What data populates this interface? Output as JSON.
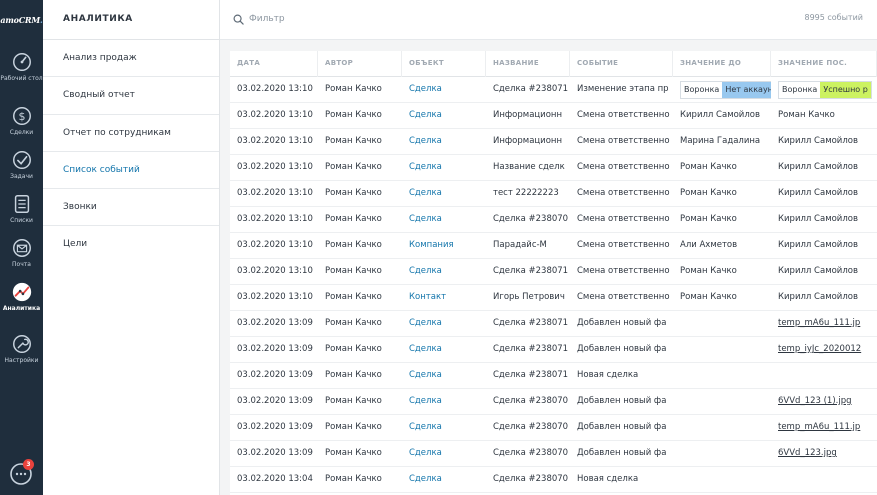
{
  "brand": {
    "logo_text": "amoCRM",
    "logo_dot": "."
  },
  "rail": [
    {
      "name": "dashboard",
      "label": "Рабочий стол",
      "active": false
    },
    {
      "name": "leads",
      "label": "Сделки",
      "active": false
    },
    {
      "name": "tasks",
      "label": "Задачи",
      "active": false
    },
    {
      "name": "lists",
      "label": "Списки",
      "active": false
    },
    {
      "name": "mail",
      "label": "Почта",
      "active": false
    },
    {
      "name": "analytics",
      "label": "Аналитика",
      "active": true
    },
    {
      "name": "settings",
      "label": "Настройки",
      "active": false
    }
  ],
  "chat": {
    "badge": "3"
  },
  "sidebar": {
    "title": "АНАЛИТИКА",
    "items": [
      {
        "label": "Анализ продаж"
      },
      {
        "label": "Сводный отчет"
      },
      {
        "label": "Отчет по сотрудникам"
      },
      {
        "label": "Список событий"
      },
      {
        "label": "Звонки"
      },
      {
        "label": "Цели"
      }
    ]
  },
  "search": {
    "placeholder": "Фильтр",
    "value": ""
  },
  "events_count": "8995 событий",
  "table": {
    "columns": [
      "ДАТА",
      "АВТОР",
      "ОБЪЕКТ",
      "НАЗВАНИЕ",
      "СОБЫТИЕ",
      "ЗНАЧЕНИЕ ДО",
      "ЗНАЧЕНИЕ ПОС."
    ],
    "rows": [
      {
        "date": "03.02.2020 13:10",
        "author": "Роман Качко",
        "object": "Сделка",
        "name": "Сделка #238071",
        "event": "Изменение этапа пр",
        "before": "",
        "after": "",
        "before_pill": [
          "Воронка",
          "Нет аккаун"
        ],
        "after_pill": [
          "Воронка",
          "Успешно р"
        ]
      },
      {
        "date": "03.02.2020 13:10",
        "author": "Роман Качко",
        "object": "Сделка",
        "name": "Информационн",
        "event": "Смена ответственно",
        "before": "Кирилл Самойлов",
        "after": "Роман Качко"
      },
      {
        "date": "03.02.2020 13:10",
        "author": "Роман Качко",
        "object": "Сделка",
        "name": "Информационн",
        "event": "Смена ответственно",
        "before": "Марина Гадалина",
        "after": "Кирилл Самойлов"
      },
      {
        "date": "03.02.2020 13:10",
        "author": "Роман Качко",
        "object": "Сделка",
        "name": "Название сделк",
        "event": "Смена ответственно",
        "before": "Роман Качко",
        "after": "Кирилл Самойлов"
      },
      {
        "date": "03.02.2020 13:10",
        "author": "Роман Качко",
        "object": "Сделка",
        "name": "тест 22222223",
        "event": "Смена ответственно",
        "before": "Роман Качко",
        "after": "Кирилл Самойлов"
      },
      {
        "date": "03.02.2020 13:10",
        "author": "Роман Качко",
        "object": "Сделка",
        "name": "Сделка #238070",
        "event": "Смена ответственно",
        "before": "Роман Качко",
        "after": "Кирилл Самойлов"
      },
      {
        "date": "03.02.2020 13:10",
        "author": "Роман Качко",
        "object": "Компания",
        "name": "Парадайс-М",
        "event": "Смена ответственно",
        "before": "Али Ахметов",
        "after": "Кирилл Самойлов"
      },
      {
        "date": "03.02.2020 13:10",
        "author": "Роман Качко",
        "object": "Сделка",
        "name": "Сделка #238071",
        "event": "Смена ответственно",
        "before": "Роман Качко",
        "after": "Кирилл Самойлов"
      },
      {
        "date": "03.02.2020 13:10",
        "author": "Роман Качко",
        "object": "Контакт",
        "name": "Игорь Петрович",
        "event": "Смена ответственно",
        "before": "Роман Качко",
        "after": "Кирилл Самойлов"
      },
      {
        "date": "03.02.2020 13:09",
        "author": "Роман Качко",
        "object": "Сделка",
        "name": "Сделка #238071",
        "event": "Добавлен новый фа",
        "before": "",
        "after": "temp_mA6u_111.jp",
        "after_file": true
      },
      {
        "date": "03.02.2020 13:09",
        "author": "Роман Качко",
        "object": "Сделка",
        "name": "Сделка #238071",
        "event": "Добавлен новый фа",
        "before": "",
        "after": "temp_iyJc_2020012",
        "after_file": true
      },
      {
        "date": "03.02.2020 13:09",
        "author": "Роман Качко",
        "object": "Сделка",
        "name": "Сделка #238071",
        "event": "Новая сделка",
        "before": "",
        "after": ""
      },
      {
        "date": "03.02.2020 13:09",
        "author": "Роман Качко",
        "object": "Сделка",
        "name": "Сделка #238070",
        "event": "Добавлен новый фа",
        "before": "",
        "after": "6VVd_123 (1).jpg",
        "after_file": true
      },
      {
        "date": "03.02.2020 13:09",
        "author": "Роман Качко",
        "object": "Сделка",
        "name": "Сделка #238070",
        "event": "Добавлен новый фа",
        "before": "",
        "after": "temp_mA6u_111.jp",
        "after_file": true
      },
      {
        "date": "03.02.2020 13:09",
        "author": "Роман Качко",
        "object": "Сделка",
        "name": "Сделка #238070",
        "event": "Добавлен новый фа",
        "before": "",
        "after": "6VVd_123.jpg",
        "after_file": true
      },
      {
        "date": "03.02.2020 13:04",
        "author": "Роман Качко",
        "object": "Сделка",
        "name": "Сделка #238070",
        "event": "Новая сделка",
        "before": "",
        "after": ""
      }
    ]
  },
  "colors": {
    "rail_bg": "#1f2e3d",
    "link": "#1375ab",
    "pill_blue": "#98c8ef",
    "pill_green": "#ccf261",
    "badge": "#e9423d"
  }
}
